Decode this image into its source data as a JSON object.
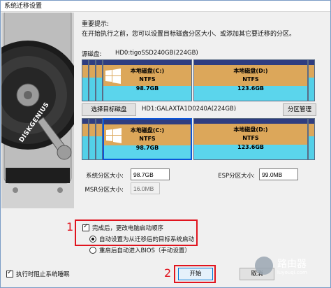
{
  "window": {
    "title": "系统迁移设置"
  },
  "notice": {
    "title": "重要提示:",
    "text": "在开始执行之前，您可以设置目标磁盘分区大小、或添加其它要迁移的分区。"
  },
  "side_graphic": {
    "brand": "DISKGENIUS"
  },
  "source": {
    "label": "源磁盘:",
    "disk_name": "HD0:tigoSSD240GB(224GB)",
    "partitions": [
      {
        "name": "本地磁盘(C:)",
        "fs": "NTFS",
        "size": "98.7GB",
        "icon": "windows-logo-icon"
      },
      {
        "name": "本地磁盘(D:)",
        "fs": "NTFS",
        "size": "123.6GB"
      }
    ]
  },
  "target": {
    "select_button": "选择目标磁盘",
    "disk_name": "HD1:GALAXTA1D0240A(224GB)",
    "partition_button": "分区管理",
    "partitions": [
      {
        "name": "本地磁盘(C:)",
        "fs": "NTFS",
        "size": "98.7GB",
        "icon": "windows-logo-icon"
      },
      {
        "name": "本地磁盘(D:)",
        "fs": "NTFS",
        "size": "123.6GB"
      }
    ]
  },
  "fields": {
    "system_partition_label": "系统分区大小:",
    "system_partition_value": "98.7GB",
    "esp_label": "ESP分区大小:",
    "esp_value": "99.0MB",
    "msr_label": "MSR分区大小:",
    "msr_value": "16.0MB"
  },
  "options": {
    "change_boot": {
      "label": "完成后，更改电脑启动顺序",
      "checked": true
    },
    "boot_auto": {
      "label": "自动设置为从迁移后的目标系统启动",
      "selected": true
    },
    "boot_bios": {
      "label": "重启后自动进入BIOS（手动设置）",
      "selected": false
    },
    "prevent_sleep": {
      "label": "执行时阻止系统睡眠",
      "checked": true
    }
  },
  "buttons": {
    "start": "开始",
    "cancel": "取消"
  },
  "annotations": {
    "marker1": "1",
    "marker2": "2"
  },
  "watermark": {
    "name": "路由器",
    "site": "luyouqi.com"
  },
  "colors": {
    "accent_red": "#e0141e",
    "partition_cyan": "#5bd5ec",
    "partition_used": "#dca75a",
    "partition_header": "#2f3d80"
  }
}
